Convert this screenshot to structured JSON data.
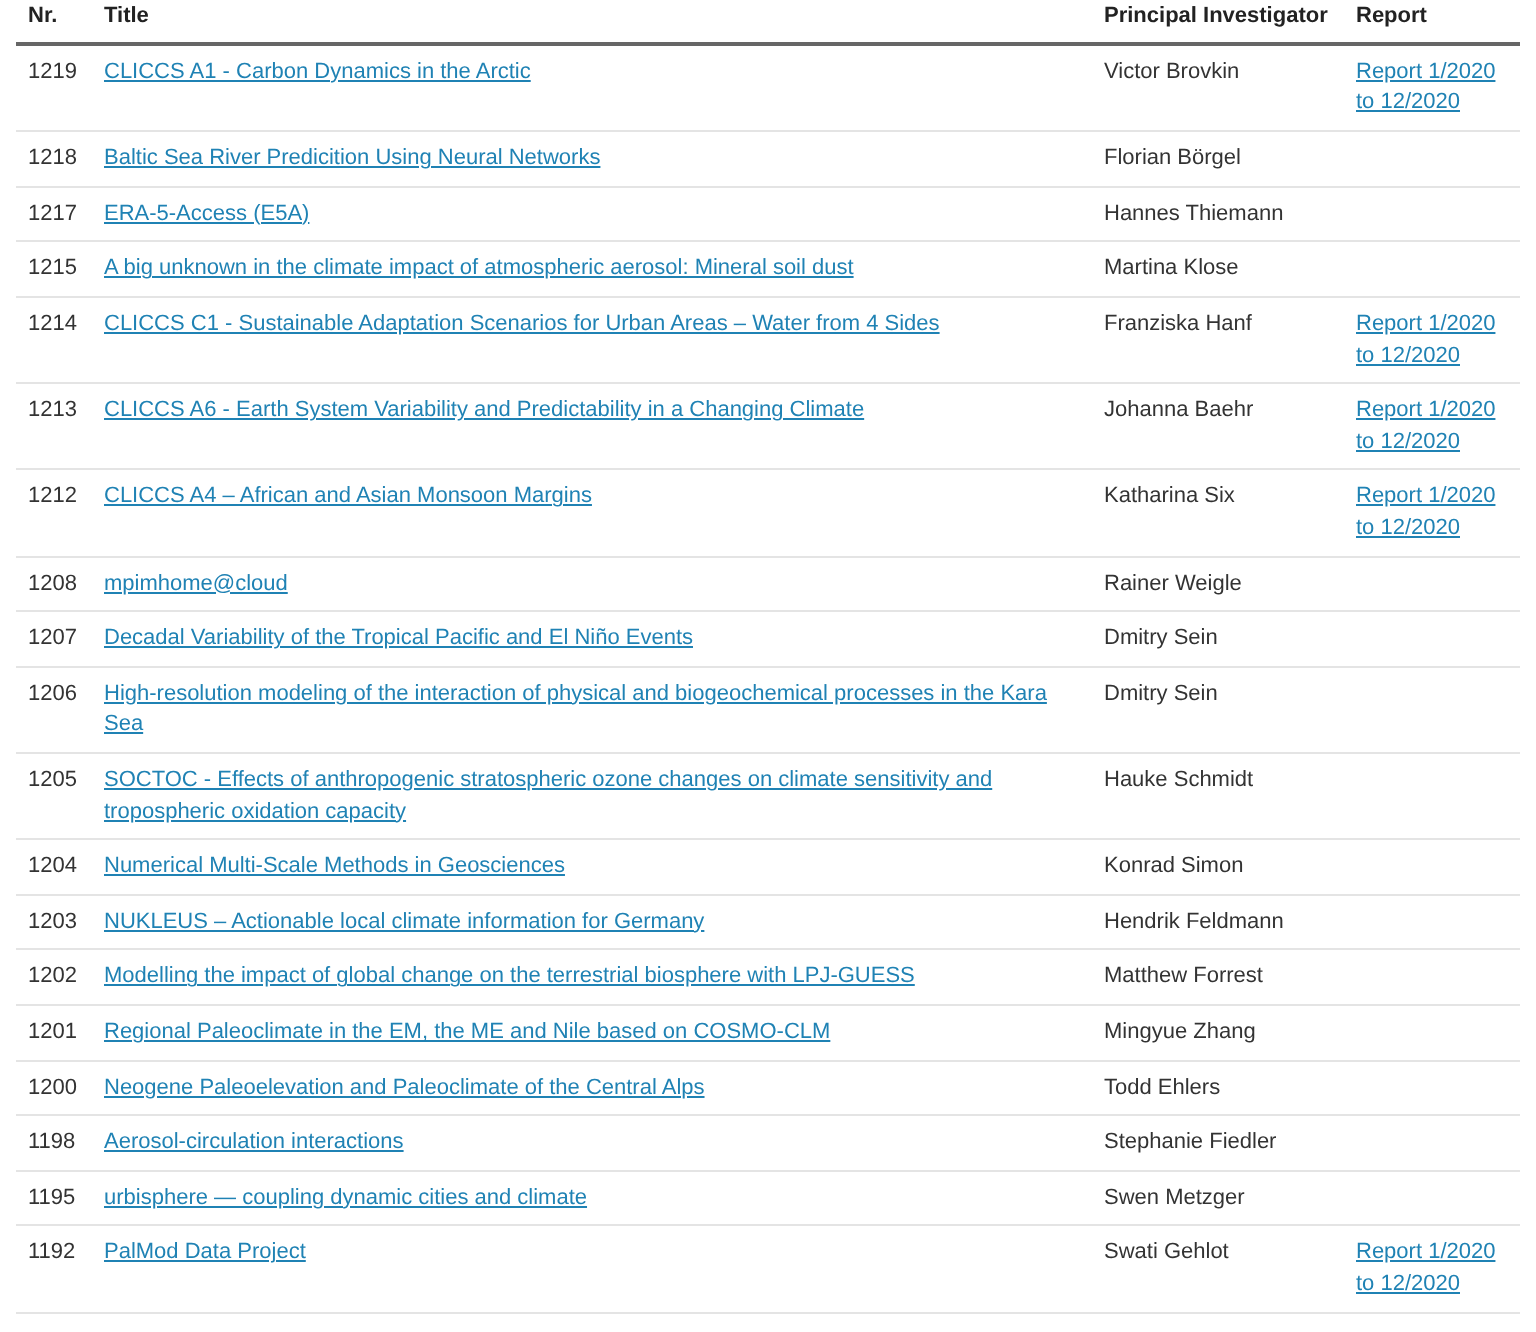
{
  "table": {
    "columns": [
      "Nr.",
      "Title",
      "Principal Investigator",
      "Report"
    ],
    "rows": [
      {
        "nr": "1219",
        "title": "CLICCS A1 - Carbon Dynamics in the Arctic",
        "investigator": "Victor Brovkin",
        "report": "Report 1/2020 to 12/2020"
      },
      {
        "nr": "1218",
        "title": "Baltic Sea River Predicition Using Neural Networks",
        "investigator": "Florian Börgel"
      },
      {
        "nr": "1217",
        "title": "ERA-5-Access (E5A)",
        "investigator": "Hannes Thiemann"
      },
      {
        "nr": "1215",
        "title": "A big unknown in the climate impact of atmospheric aerosol: Mineral soil dust",
        "investigator": "Martina Klose"
      },
      {
        "nr": "1214",
        "title": "CLICCS C1 - Sustainable Adaptation Scenarios for Urban Areas – Water from 4 Sides",
        "investigator": "Franziska Hanf",
        "report": "Report 1/2020 to 12/2020"
      },
      {
        "nr": "1213",
        "title": "CLICCS A6 - Earth System Variability and Predictability in a Changing Climate",
        "investigator": "Johanna Baehr",
        "report": "Report 1/2020 to 12/2020"
      },
      {
        "nr": "1212",
        "title": "CLICCS A4 – African and Asian Monsoon Margins",
        "investigator": "Katharina Six",
        "report": "Report 1/2020 to 12/2020"
      },
      {
        "nr": "1208",
        "title": "mpimhome@cloud",
        "investigator": "Rainer Weigle"
      },
      {
        "nr": "1207",
        "title": "Decadal Variability of the Tropical Pacific and El Niño Events",
        "investigator": "Dmitry Sein"
      },
      {
        "nr": "1206",
        "title": "High-resolution modeling of the interaction of physical and biogeochemical processes in the Kara Sea",
        "investigator": "Dmitry Sein"
      },
      {
        "nr": "1205",
        "title": "SOCTOC - Effects of anthropogenic stratospheric ozone changes on climate sensitivity and tropospheric oxidation capacity",
        "investigator": "Hauke Schmidt"
      },
      {
        "nr": "1204",
        "title": "Numerical Multi-Scale Methods in Geosciences",
        "investigator": "Konrad Simon"
      },
      {
        "nr": "1203",
        "title": "NUKLEUS – Actionable local climate information for Germany",
        "investigator": "Hendrik Feldmann"
      },
      {
        "nr": "1202",
        "title": "Modelling the impact of global change on the terrestrial biosphere with LPJ-GUESS",
        "investigator": "Matthew Forrest"
      },
      {
        "nr": "1201",
        "title": "Regional Paleoclimate in the EM, the ME and Nile based on COSMO-CLM",
        "investigator": "Mingyue Zhang"
      },
      {
        "nr": "1200",
        "title": "Neogene Paleoelevation and Paleoclimate of the Central Alps",
        "investigator": "Todd Ehlers"
      },
      {
        "nr": "1198",
        "title": "Aerosol-circulation interactions",
        "investigator": "Stephanie Fiedler"
      },
      {
        "nr": "1195",
        "title": "urbisphere — coupling dynamic cities and climate",
        "investigator": "Swen Metzger"
      },
      {
        "nr": "1192",
        "title": "PalMod Data Project",
        "investigator": "Swati Gehlot",
        "report": "Report 1/2020 to 12/2020"
      }
    ]
  }
}
